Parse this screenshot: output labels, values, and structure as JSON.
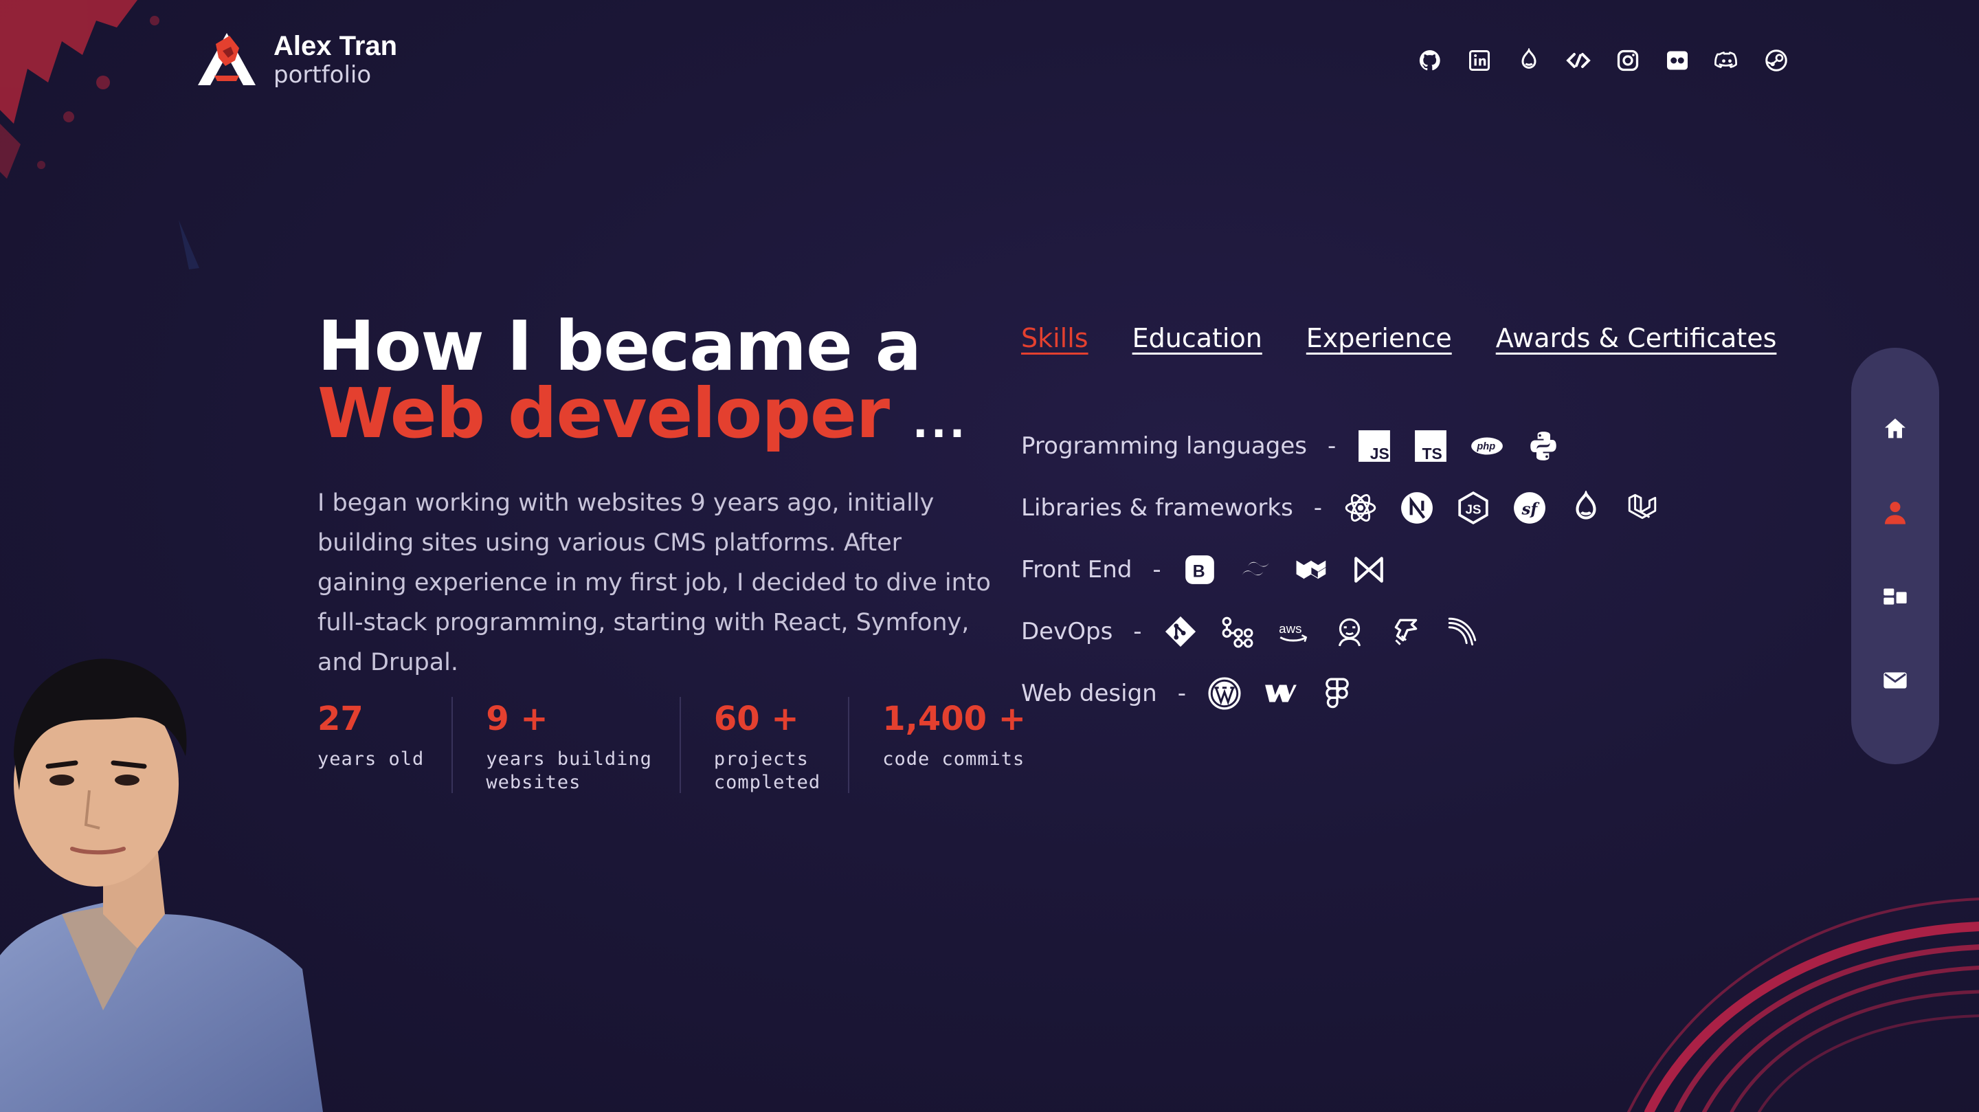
{
  "brand": {
    "name": "Alex Tran",
    "subtitle": "portfolio"
  },
  "social": [
    {
      "icon": "github-icon"
    },
    {
      "icon": "linkedin-icon"
    },
    {
      "icon": "drupal-icon"
    },
    {
      "icon": "codersrank-icon"
    },
    {
      "icon": "instagram-icon"
    },
    {
      "icon": "flickr-icon"
    },
    {
      "icon": "discord-icon"
    },
    {
      "icon": "steam-icon"
    }
  ],
  "hero": {
    "title_line1": "How I became a",
    "title_line2": "Web developer",
    "title_suffix": "...",
    "description": "I began working with websites 9 years ago, initially building sites using various CMS platforms. After gaining experience in my first job, I decided to dive into full-stack programming, starting with React, Symfony, and Drupal."
  },
  "stats": [
    {
      "value": "27",
      "label_line1": "years old",
      "label_line2": ""
    },
    {
      "value": "9 +",
      "label_line1": "years building",
      "label_line2": "websites"
    },
    {
      "value": "60 +",
      "label_line1": "projects",
      "label_line2": "completed"
    },
    {
      "value": "1,400 +",
      "label_line1": "code commits",
      "label_line2": ""
    }
  ],
  "tabs": [
    {
      "label": "Skills",
      "active": true
    },
    {
      "label": "Education",
      "active": false
    },
    {
      "label": "Experience",
      "active": false
    },
    {
      "label": "Awards & Certificates",
      "active": false
    }
  ],
  "skills": {
    "separator": "-",
    "rows": [
      {
        "label": "Programming languages",
        "icons": [
          "javascript-icon",
          "typescript-icon",
          "php-icon",
          "python-icon"
        ]
      },
      {
        "label": "Libraries & frameworks",
        "icons": [
          "react-icon",
          "nextjs-icon",
          "nodejs-icon",
          "symfony-icon",
          "drupal-icon",
          "laravel-icon"
        ]
      },
      {
        "label": "Front End",
        "icons": [
          "bootstrap-icon",
          "tailwind-icon",
          "mui-icon",
          "chakra-icon"
        ]
      },
      {
        "label": "DevOps",
        "icons": [
          "git-icon",
          "gitlab-ci-icon",
          "aws-icon",
          "jenkins-icon",
          "jira-icon",
          "pipeline-icon"
        ]
      },
      {
        "label": "Web design",
        "icons": [
          "wordpress-icon",
          "webflow-icon",
          "figma-icon"
        ]
      }
    ]
  },
  "sidenav": [
    {
      "icon": "home-icon",
      "active": false
    },
    {
      "icon": "user-icon",
      "active": true
    },
    {
      "icon": "projects-icon",
      "active": false
    },
    {
      "icon": "mail-icon",
      "active": false
    }
  ],
  "colors": {
    "accent": "#e4402f",
    "background": "#1c1738",
    "nav_bg": "#3a3660"
  },
  "aws_text": "aws"
}
